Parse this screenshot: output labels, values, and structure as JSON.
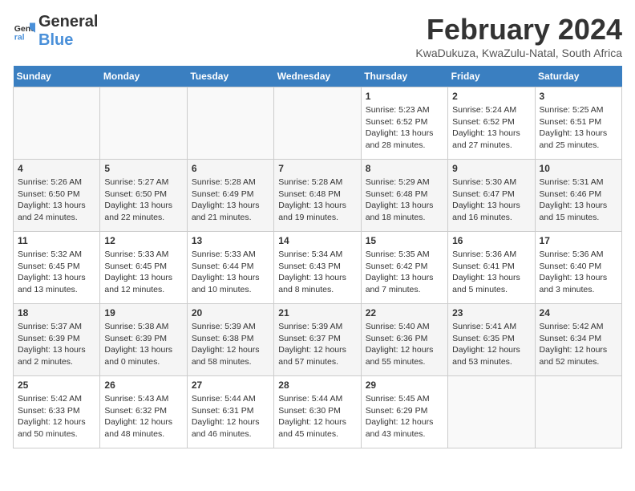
{
  "header": {
    "logo_general": "General",
    "logo_blue": "Blue",
    "title": "February 2024",
    "subtitle": "KwaDukuza, KwaZulu-Natal, South Africa"
  },
  "days_of_week": [
    "Sunday",
    "Monday",
    "Tuesday",
    "Wednesday",
    "Thursday",
    "Friday",
    "Saturday"
  ],
  "weeks": [
    [
      {
        "day": "",
        "detail": ""
      },
      {
        "day": "",
        "detail": ""
      },
      {
        "day": "",
        "detail": ""
      },
      {
        "day": "",
        "detail": ""
      },
      {
        "day": "1",
        "detail": "Sunrise: 5:23 AM\nSunset: 6:52 PM\nDaylight: 13 hours and 28 minutes."
      },
      {
        "day": "2",
        "detail": "Sunrise: 5:24 AM\nSunset: 6:52 PM\nDaylight: 13 hours and 27 minutes."
      },
      {
        "day": "3",
        "detail": "Sunrise: 5:25 AM\nSunset: 6:51 PM\nDaylight: 13 hours and 25 minutes."
      }
    ],
    [
      {
        "day": "4",
        "detail": "Sunrise: 5:26 AM\nSunset: 6:50 PM\nDaylight: 13 hours and 24 minutes."
      },
      {
        "day": "5",
        "detail": "Sunrise: 5:27 AM\nSunset: 6:50 PM\nDaylight: 13 hours and 22 minutes."
      },
      {
        "day": "6",
        "detail": "Sunrise: 5:28 AM\nSunset: 6:49 PM\nDaylight: 13 hours and 21 minutes."
      },
      {
        "day": "7",
        "detail": "Sunrise: 5:28 AM\nSunset: 6:48 PM\nDaylight: 13 hours and 19 minutes."
      },
      {
        "day": "8",
        "detail": "Sunrise: 5:29 AM\nSunset: 6:48 PM\nDaylight: 13 hours and 18 minutes."
      },
      {
        "day": "9",
        "detail": "Sunrise: 5:30 AM\nSunset: 6:47 PM\nDaylight: 13 hours and 16 minutes."
      },
      {
        "day": "10",
        "detail": "Sunrise: 5:31 AM\nSunset: 6:46 PM\nDaylight: 13 hours and 15 minutes."
      }
    ],
    [
      {
        "day": "11",
        "detail": "Sunrise: 5:32 AM\nSunset: 6:45 PM\nDaylight: 13 hours and 13 minutes."
      },
      {
        "day": "12",
        "detail": "Sunrise: 5:33 AM\nSunset: 6:45 PM\nDaylight: 13 hours and 12 minutes."
      },
      {
        "day": "13",
        "detail": "Sunrise: 5:33 AM\nSunset: 6:44 PM\nDaylight: 13 hours and 10 minutes."
      },
      {
        "day": "14",
        "detail": "Sunrise: 5:34 AM\nSunset: 6:43 PM\nDaylight: 13 hours and 8 minutes."
      },
      {
        "day": "15",
        "detail": "Sunrise: 5:35 AM\nSunset: 6:42 PM\nDaylight: 13 hours and 7 minutes."
      },
      {
        "day": "16",
        "detail": "Sunrise: 5:36 AM\nSunset: 6:41 PM\nDaylight: 13 hours and 5 minutes."
      },
      {
        "day": "17",
        "detail": "Sunrise: 5:36 AM\nSunset: 6:40 PM\nDaylight: 13 hours and 3 minutes."
      }
    ],
    [
      {
        "day": "18",
        "detail": "Sunrise: 5:37 AM\nSunset: 6:39 PM\nDaylight: 13 hours and 2 minutes."
      },
      {
        "day": "19",
        "detail": "Sunrise: 5:38 AM\nSunset: 6:39 PM\nDaylight: 13 hours and 0 minutes."
      },
      {
        "day": "20",
        "detail": "Sunrise: 5:39 AM\nSunset: 6:38 PM\nDaylight: 12 hours and 58 minutes."
      },
      {
        "day": "21",
        "detail": "Sunrise: 5:39 AM\nSunset: 6:37 PM\nDaylight: 12 hours and 57 minutes."
      },
      {
        "day": "22",
        "detail": "Sunrise: 5:40 AM\nSunset: 6:36 PM\nDaylight: 12 hours and 55 minutes."
      },
      {
        "day": "23",
        "detail": "Sunrise: 5:41 AM\nSunset: 6:35 PM\nDaylight: 12 hours and 53 minutes."
      },
      {
        "day": "24",
        "detail": "Sunrise: 5:42 AM\nSunset: 6:34 PM\nDaylight: 12 hours and 52 minutes."
      }
    ],
    [
      {
        "day": "25",
        "detail": "Sunrise: 5:42 AM\nSunset: 6:33 PM\nDaylight: 12 hours and 50 minutes."
      },
      {
        "day": "26",
        "detail": "Sunrise: 5:43 AM\nSunset: 6:32 PM\nDaylight: 12 hours and 48 minutes."
      },
      {
        "day": "27",
        "detail": "Sunrise: 5:44 AM\nSunset: 6:31 PM\nDaylight: 12 hours and 46 minutes."
      },
      {
        "day": "28",
        "detail": "Sunrise: 5:44 AM\nSunset: 6:30 PM\nDaylight: 12 hours and 45 minutes."
      },
      {
        "day": "29",
        "detail": "Sunrise: 5:45 AM\nSunset: 6:29 PM\nDaylight: 12 hours and 43 minutes."
      },
      {
        "day": "",
        "detail": ""
      },
      {
        "day": "",
        "detail": ""
      }
    ]
  ]
}
